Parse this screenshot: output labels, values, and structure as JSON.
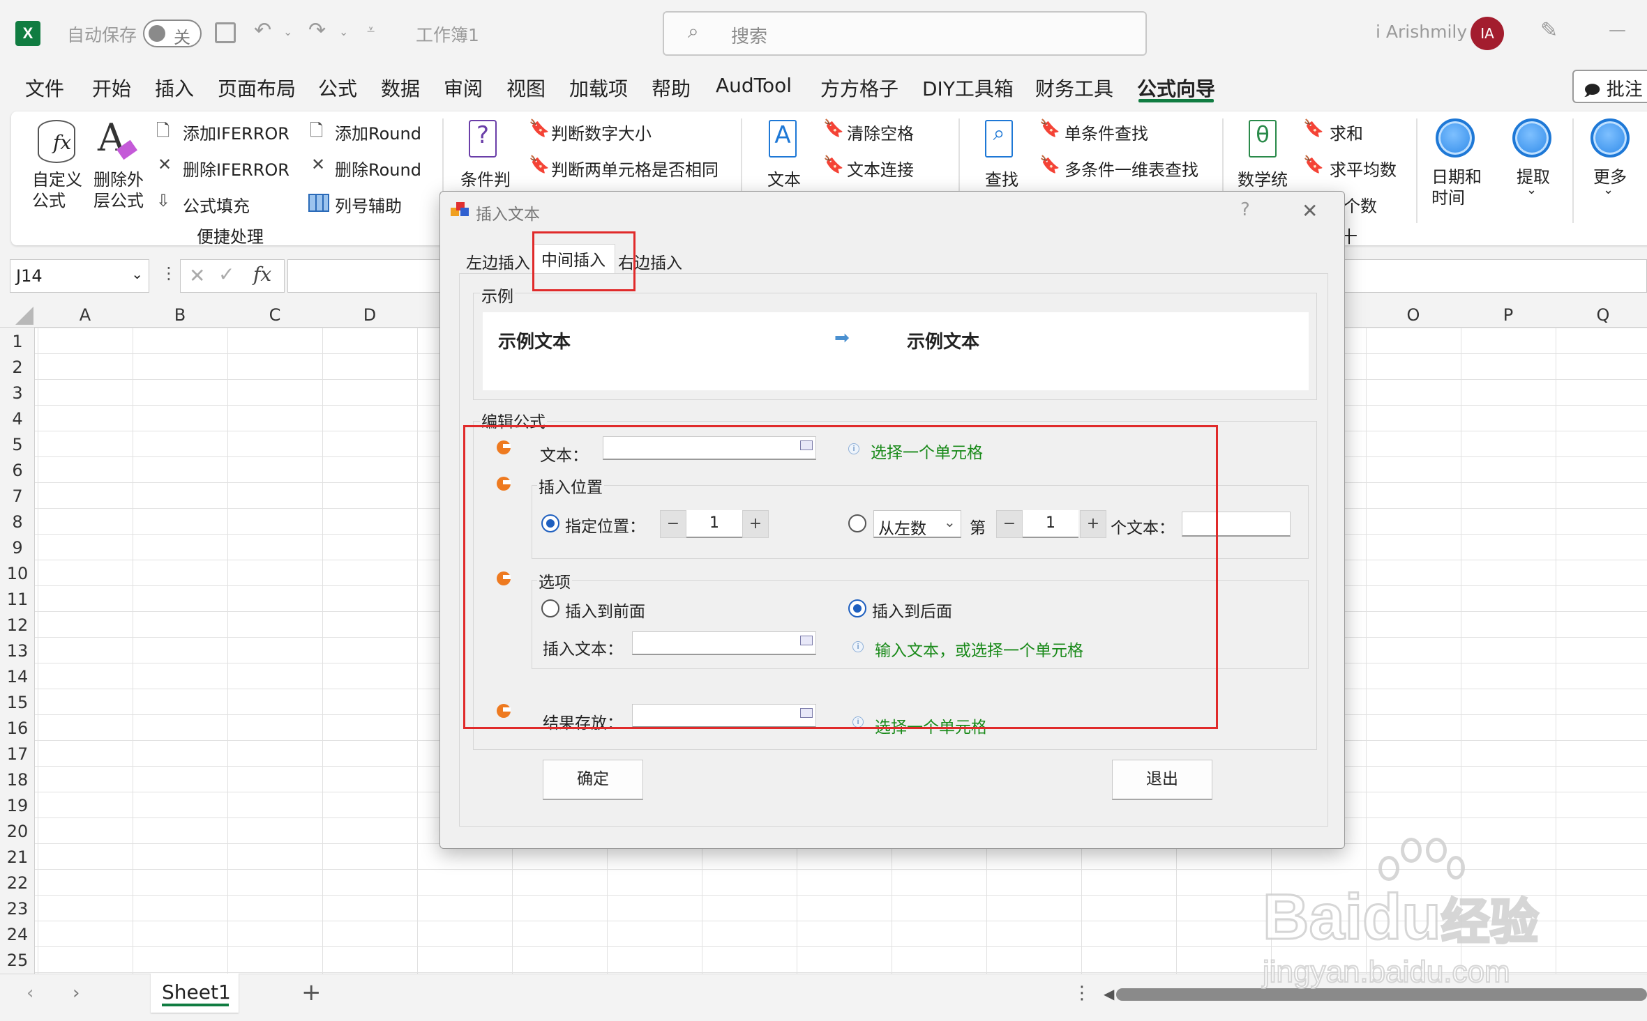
{
  "titlebar": {
    "autosave_label": "自动保存",
    "autosave_state": "关",
    "workbook_name": "工作簿1",
    "search_placeholder": "搜索",
    "user_name": "i Arishmily",
    "user_initials": "IA",
    "minimize_label": "—"
  },
  "menu": {
    "tabs": [
      "文件",
      "开始",
      "插入",
      "页面布局",
      "公式",
      "数据",
      "审阅",
      "视图",
      "加载项",
      "帮助",
      "AudTool",
      "方方格子",
      "DIY工具箱",
      "财务工具",
      "公式向导"
    ],
    "active": "公式向导",
    "comment_label": "批注"
  },
  "ribbon": {
    "custom_formula": [
      "自定义",
      "公式"
    ],
    "remove_outer": [
      "删除外",
      "层公式"
    ],
    "add_iferror": "添加IFERROR",
    "del_iferror": "删除IFERROR",
    "formula_fill": "公式填充",
    "add_round": "添加Round",
    "del_round": "删除Round",
    "col_assist": "列号辅助",
    "group_label": "便捷处理",
    "cond_label": "条件判",
    "judge_size": "判断数字大小",
    "judge_same": "判断两单元格是否相同",
    "text_label": "文本",
    "clear_space": "清除空格",
    "text_concat": "文本连接",
    "find_label": "查找",
    "single_lookup": "单条件查找",
    "multi_lookup": "多条件一维表查找",
    "math_label": "数学统",
    "sum_label": "求和",
    "avg_label": "求平均数",
    "count_label": "个数",
    "plus_label": "十",
    "date_time": [
      "日期和",
      "时间"
    ],
    "extract_label": "提取",
    "more_label": "更多",
    "accent": "#107c41"
  },
  "formula_bar": {
    "name_box": "J14",
    "fx": "fx"
  },
  "grid": {
    "columns_left": [
      "A",
      "B",
      "C",
      "D"
    ],
    "columns_right": [
      "O",
      "P",
      "Q"
    ],
    "rows": [
      "1",
      "2",
      "3",
      "4",
      "5",
      "6",
      "7",
      "8",
      "9",
      "10",
      "11",
      "12",
      "13",
      "14",
      "15",
      "16",
      "17",
      "18",
      "19",
      "20",
      "21",
      "22",
      "23",
      "24",
      "25"
    ]
  },
  "sheets": {
    "tabs": [
      "Sheet1"
    ],
    "add_label": "+"
  },
  "dialog": {
    "title": "插入文本",
    "help": "?",
    "close": "✕",
    "tabs": [
      "左边插入",
      "中间插入",
      "右边插入"
    ],
    "active_tab": "中间插入",
    "example_group": "示例",
    "example_left": "示例文本",
    "example_right": "示例文本",
    "edit_group": "编辑公式",
    "text_label": "文本：",
    "text_hint": "选择一个单元格",
    "position_group": "插入位置",
    "specified_pos_label": "指定位置：",
    "specified_pos_value": "1",
    "direction_option": "从左数",
    "nth_label": "第",
    "nth_value": "1",
    "chars_label": "个文本：",
    "options_group": "选项",
    "insert_before": "插入到前面",
    "insert_after": "插入到后面",
    "insert_text_label": "插入文本：",
    "insert_text_hint": "输入文本，或选择一个单元格",
    "result_label": "结果存放：",
    "result_hint": "选择一个单元格",
    "ok_label": "确定",
    "exit_label": "退出",
    "highlight_color": "#e02a2a"
  },
  "watermark": {
    "brand_a": "Bai",
    "brand_b": "du",
    "brand_c": "经验",
    "url": "jingyan.baidu.com"
  }
}
